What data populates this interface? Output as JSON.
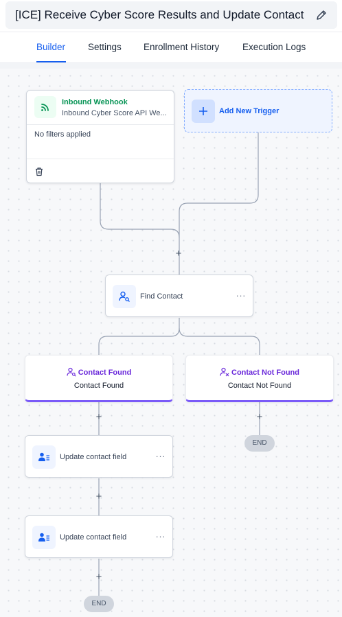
{
  "header": {
    "title": "[ICE] Receive Cyber Score Results and Update Contact",
    "edit_icon": "pencil-icon"
  },
  "tabs": [
    {
      "label": "Builder",
      "active": true
    },
    {
      "label": "Settings",
      "active": false
    },
    {
      "label": "Enrollment History",
      "active": false
    },
    {
      "label": "Execution Logs",
      "active": false
    }
  ],
  "trigger": {
    "icon": "webhook-icon",
    "name": "Inbound Webhook",
    "subtitle": "Inbound Cyber Score API We...",
    "filters": "No filters applied",
    "delete_icon": "trash-icon"
  },
  "add_trigger": {
    "label": "Add New Trigger",
    "icon": "plus-icon"
  },
  "find_contact": {
    "label": "Find Contact",
    "icon": "person-search-icon",
    "menu": "···"
  },
  "branches": {
    "found": {
      "title": "Contact Found",
      "subtitle": "Contact Found",
      "icon": "person-search-icon"
    },
    "not_found": {
      "title": "Contact Not Found",
      "subtitle": "Contact Not Found",
      "icon": "person-remove-icon"
    }
  },
  "update_actions": [
    {
      "label": "Update contact field",
      "icon": "contact-card-icon",
      "menu": "···"
    },
    {
      "label": "Update contact field",
      "icon": "contact-card-icon",
      "menu": "···"
    }
  ],
  "plus_symbol": "+",
  "end_label": "END",
  "colors": {
    "accent": "#155eef",
    "trigger_green": "#079455",
    "branch_purple": "#6927da",
    "branch_border": "#7a5af8"
  }
}
